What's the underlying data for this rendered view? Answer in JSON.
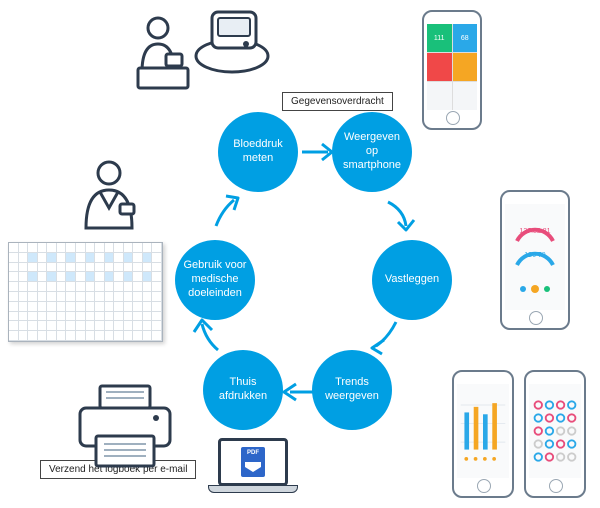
{
  "nodes": {
    "measure": "Bloeddruk meten",
    "display": "Weergeven op smartphone",
    "record": "Vastleggen",
    "trends": "Trends weergeven",
    "print": "Thuis afdrukken",
    "medical": "Gebruik voor medische doeleinden"
  },
  "labels": {
    "transfer": "Gegevensoverdracht",
    "email": "Verzend het logboek per e-mail"
  },
  "phone_tiles": {
    "a": "111",
    "b": "68"
  },
  "phone2": {
    "top": "137.82.81",
    "bottom": "126 79"
  },
  "icons": {
    "pdf": "PDF"
  }
}
